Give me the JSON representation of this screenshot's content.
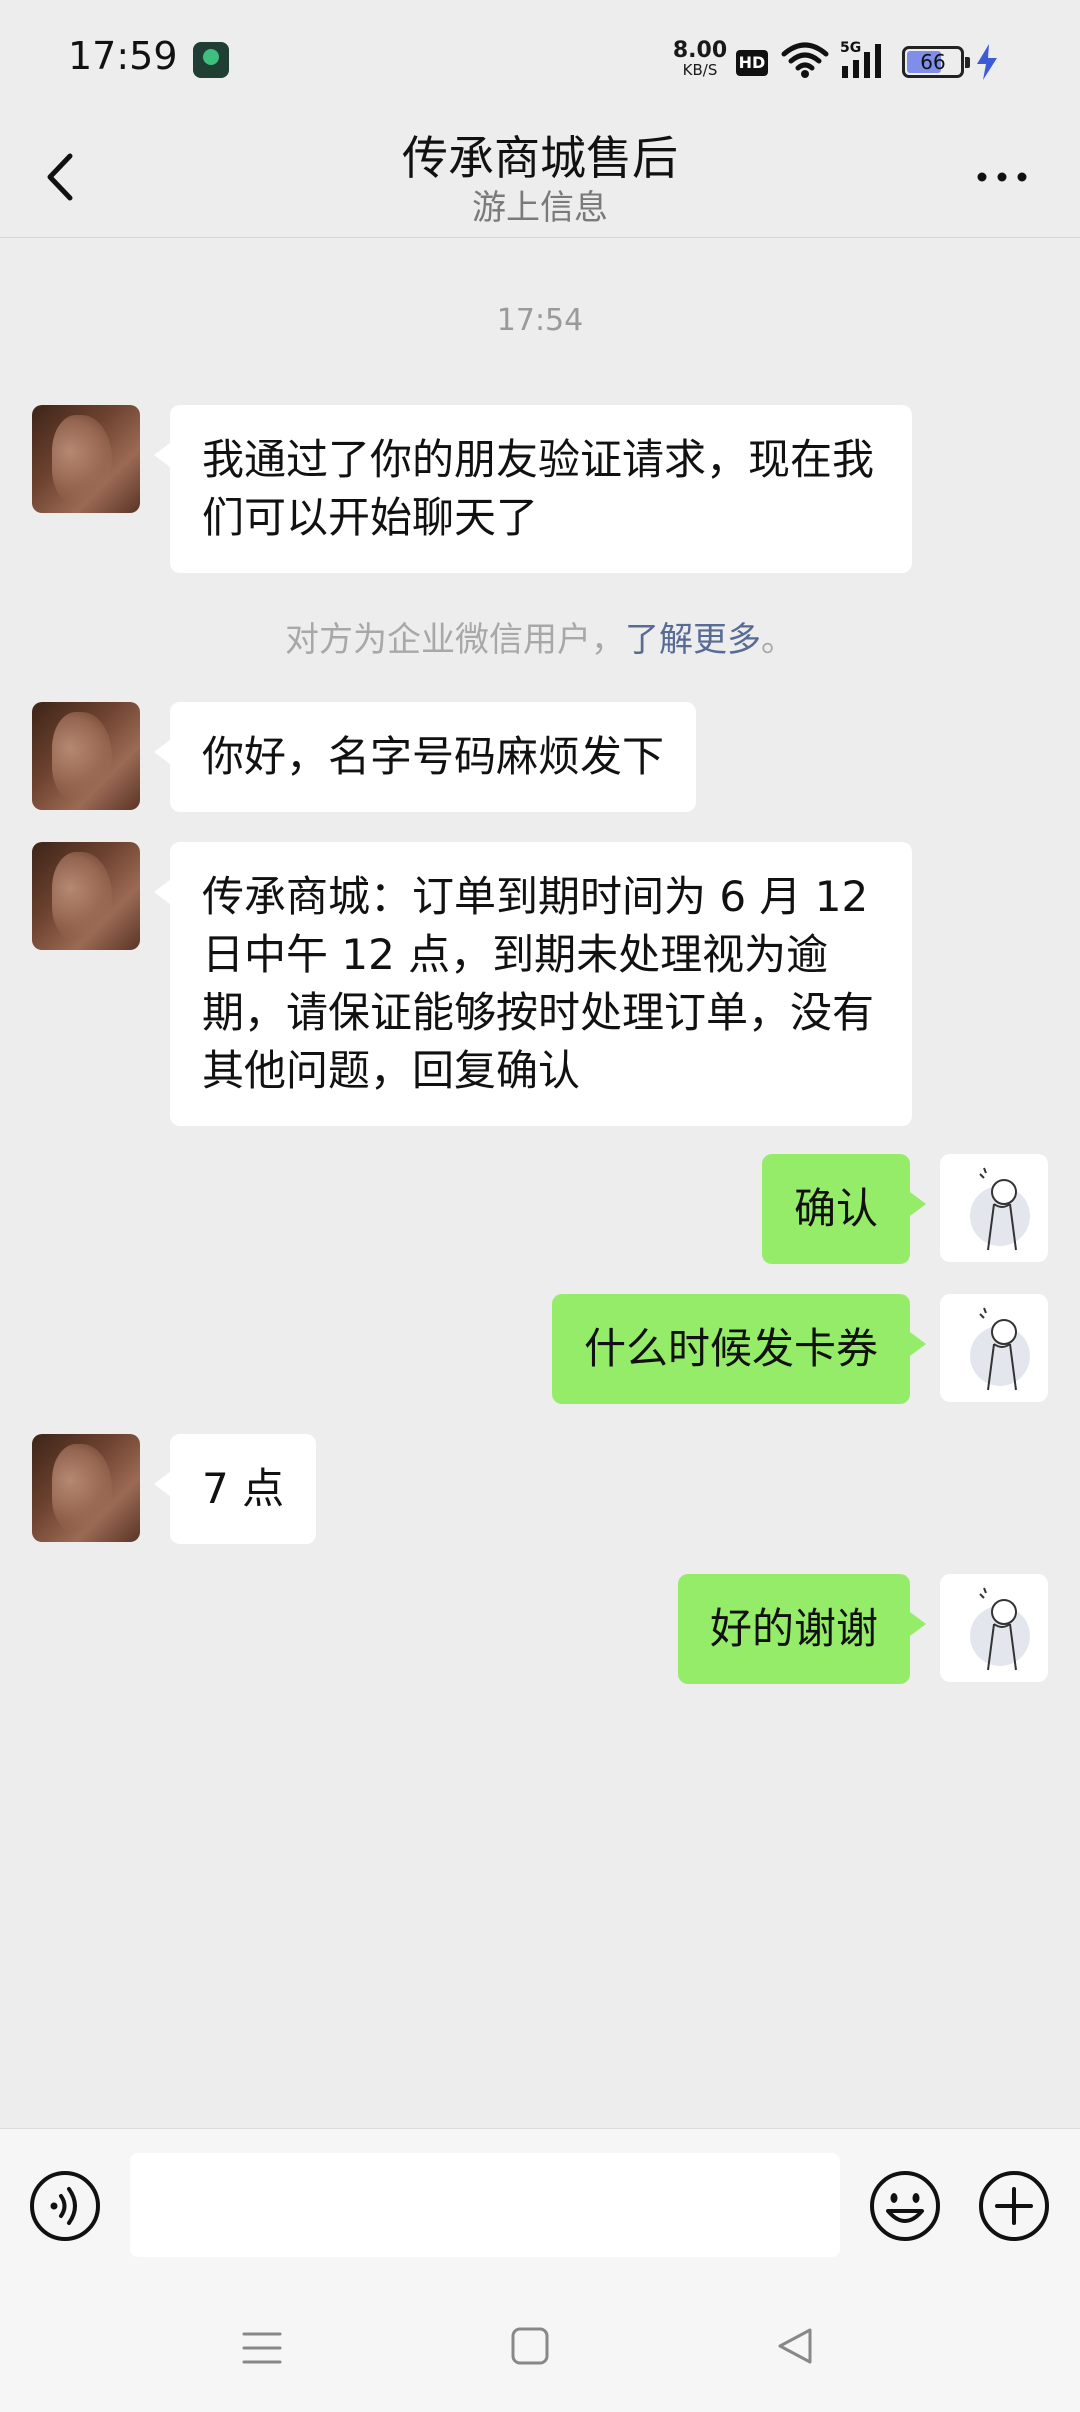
{
  "status_bar": {
    "time": "17:59",
    "speed_value": "8.00",
    "speed_unit": "KB/S",
    "hd_badge": "HD",
    "network": "5G",
    "battery": "66"
  },
  "header": {
    "title": "传承商城售后",
    "subtitle": "游上信息"
  },
  "chat": {
    "timestamp": "17:54",
    "system_note": {
      "text": "对方为企业微信用户，",
      "link": "了解更多",
      "suffix": "。"
    },
    "messages": [
      {
        "side": "in",
        "text": "我通过了你的朋友验证请求，现在我们可以开始聊天了"
      },
      {
        "side": "in",
        "text": "你好，名字号码麻烦发下"
      },
      {
        "side": "in",
        "text": "传承商城：订单到期时间为 6 月 12 日中午 12 点，到期未处理视为逾期，请保证能够按时处理订单，没有其他问题，回复确认"
      },
      {
        "side": "out",
        "text": "确认"
      },
      {
        "side": "out",
        "text": "什么时候发卡券"
      },
      {
        "side": "in",
        "text": "7 点"
      },
      {
        "side": "out",
        "text": "好的谢谢"
      }
    ]
  },
  "input_bar": {
    "placeholder": "",
    "value": ""
  },
  "colors": {
    "background": "#ededed",
    "incoming_bubble": "#ffffff",
    "outgoing_bubble": "#95ec69",
    "link": "#576b95"
  }
}
